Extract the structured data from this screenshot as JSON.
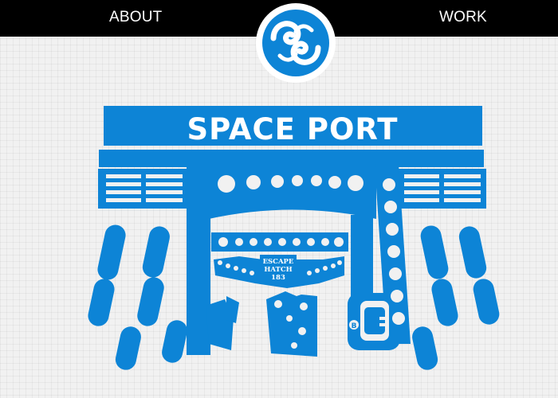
{
  "nav": {
    "about_label": "ABOUT",
    "work_label": "WORK"
  },
  "logo": {
    "icon": "swirl-logo-icon"
  },
  "artwork": {
    "sign_text": "SPACE PORT",
    "hatch_line1": "ESCAPE",
    "hatch_line2": "HATCH",
    "hatch_line3": "183",
    "button_label": "B"
  },
  "colors": {
    "accent": "#0d84d6",
    "topbar": "#000000",
    "background": "#f1f1f1"
  }
}
